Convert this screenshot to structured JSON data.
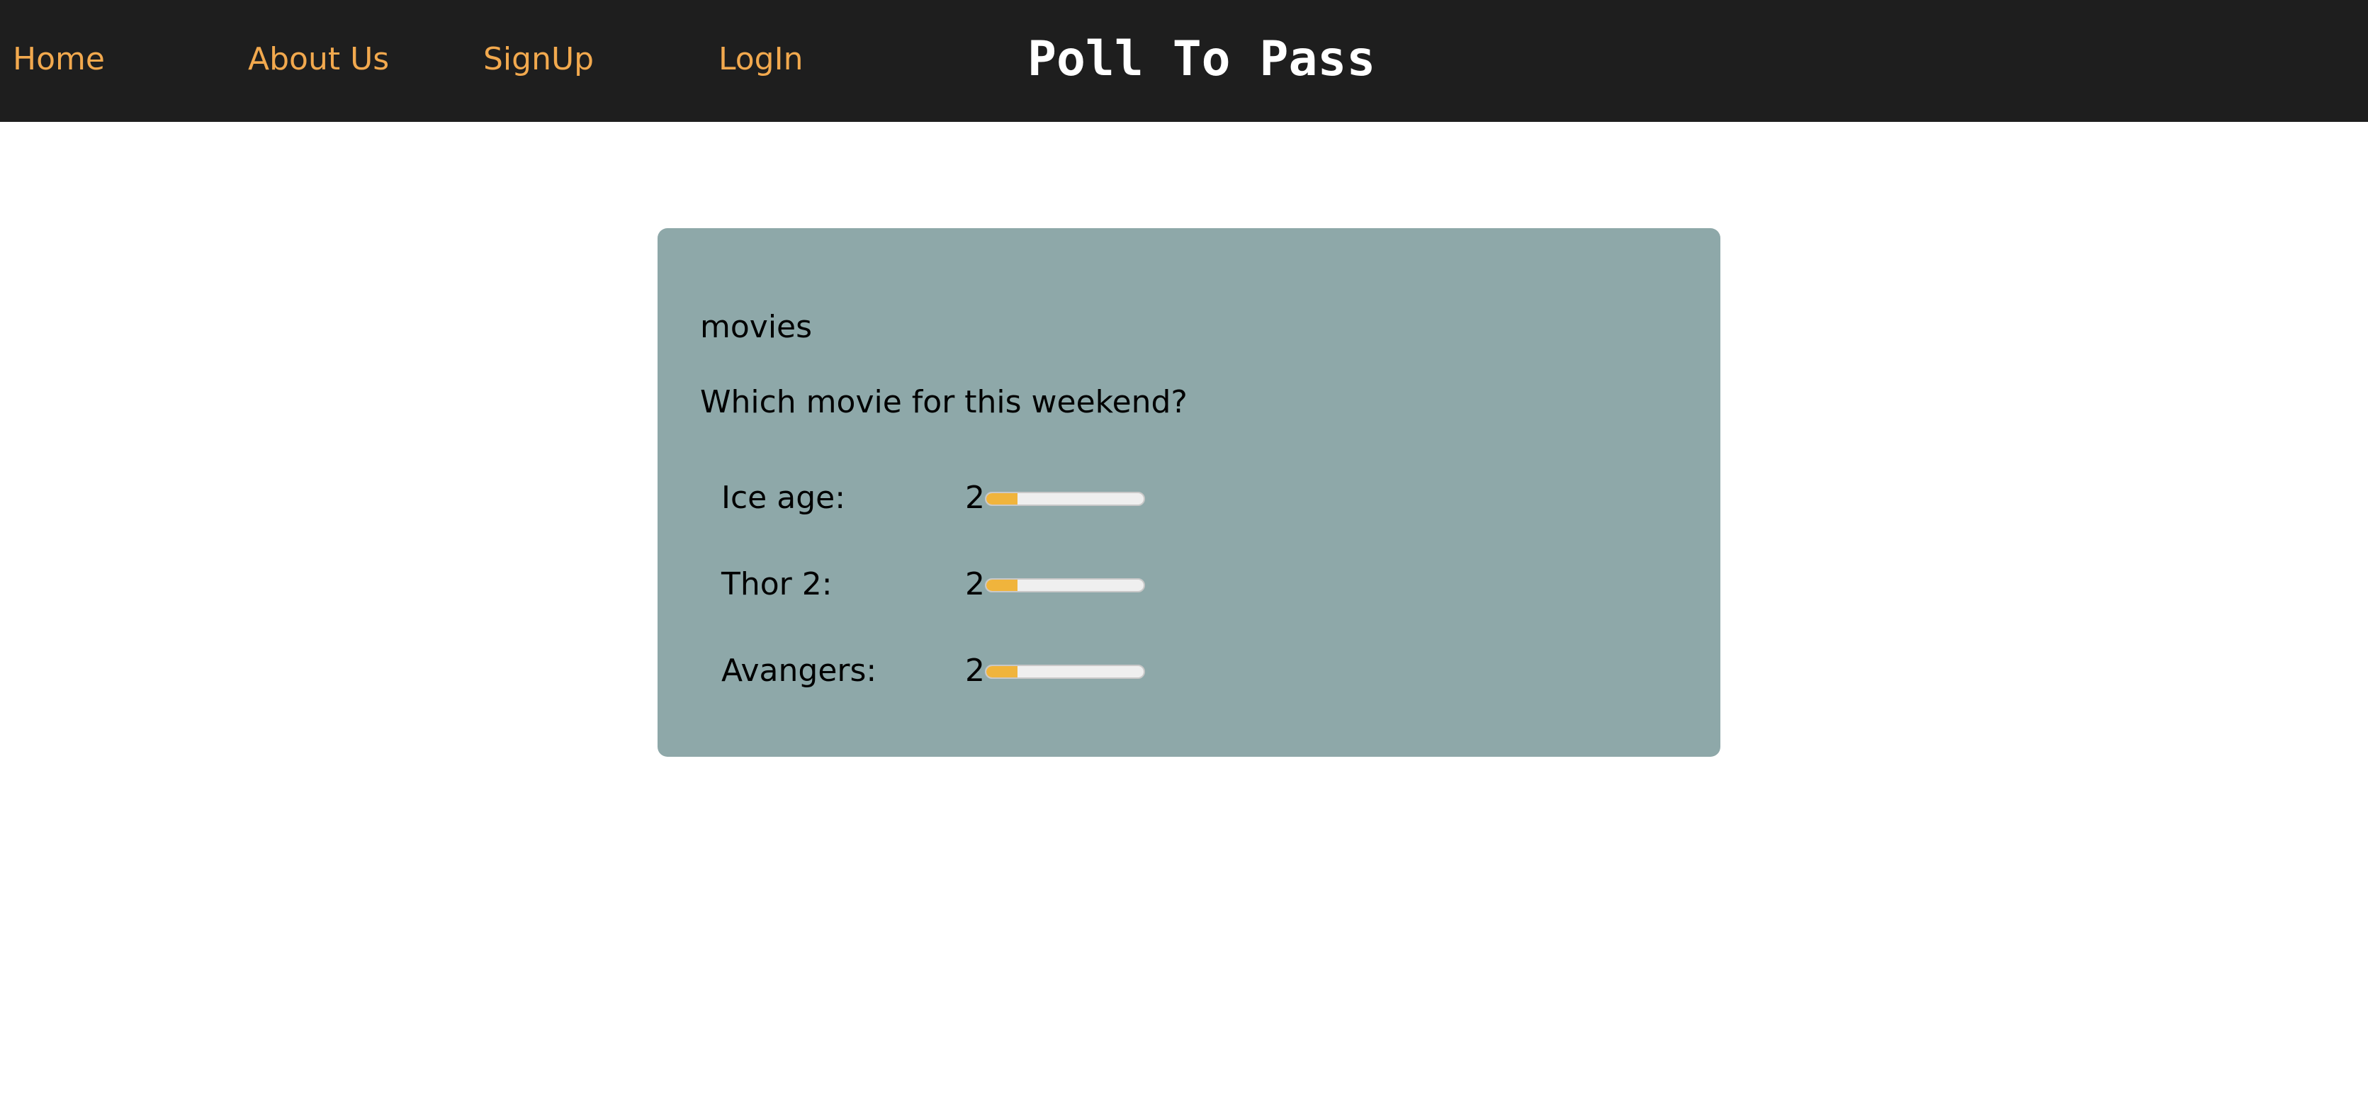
{
  "nav": {
    "home": "Home",
    "about": "About Us",
    "signup": "SignUp",
    "login": "LogIn"
  },
  "site_title": "Poll To Pass",
  "poll": {
    "category": "movies",
    "question": "Which movie for this weekend?",
    "options": [
      {
        "label": "Ice age:",
        "votes": "2",
        "fill_fraction": 0.2
      },
      {
        "label": "Thor 2:",
        "votes": "2",
        "fill_fraction": 0.2
      },
      {
        "label": "Avangers:",
        "votes": "2",
        "fill_fraction": 0.2
      }
    ]
  },
  "colors": {
    "navbar_bg": "#1e1e1e",
    "nav_link": "#f2a94e",
    "card_bg": "#8ea8a9",
    "progress_fill": "#f0b43c",
    "progress_track": "#efefef"
  }
}
